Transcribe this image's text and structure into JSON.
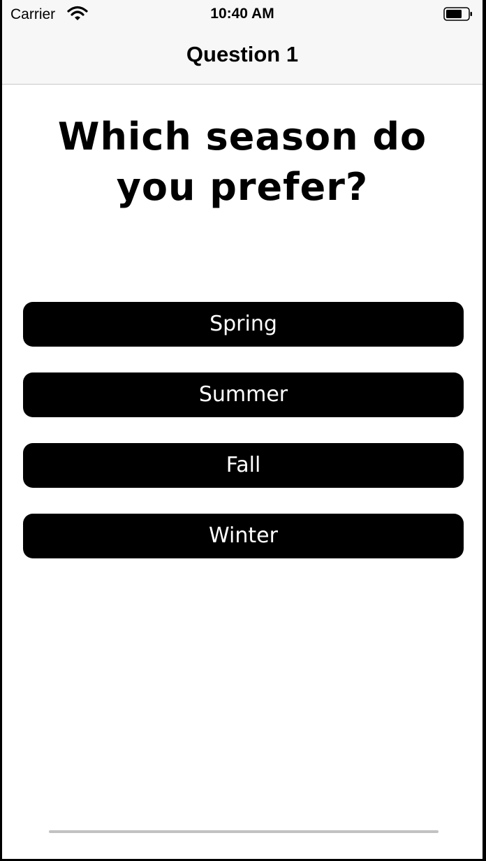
{
  "status_bar": {
    "carrier": "Carrier",
    "time": "10:40 AM",
    "wifi_icon": "wifi-icon",
    "battery_icon": "battery-icon"
  },
  "nav": {
    "title": "Question 1"
  },
  "question": {
    "text": "Which season do you prefer?"
  },
  "answers": [
    {
      "label": "Spring"
    },
    {
      "label": "Summer"
    },
    {
      "label": "Fall"
    },
    {
      "label": "Winter"
    }
  ],
  "colors": {
    "button_background": "#000000",
    "button_text": "#ffffff",
    "bar_background": "#f7f7f7",
    "home_indicator": "#c2c2c2"
  }
}
